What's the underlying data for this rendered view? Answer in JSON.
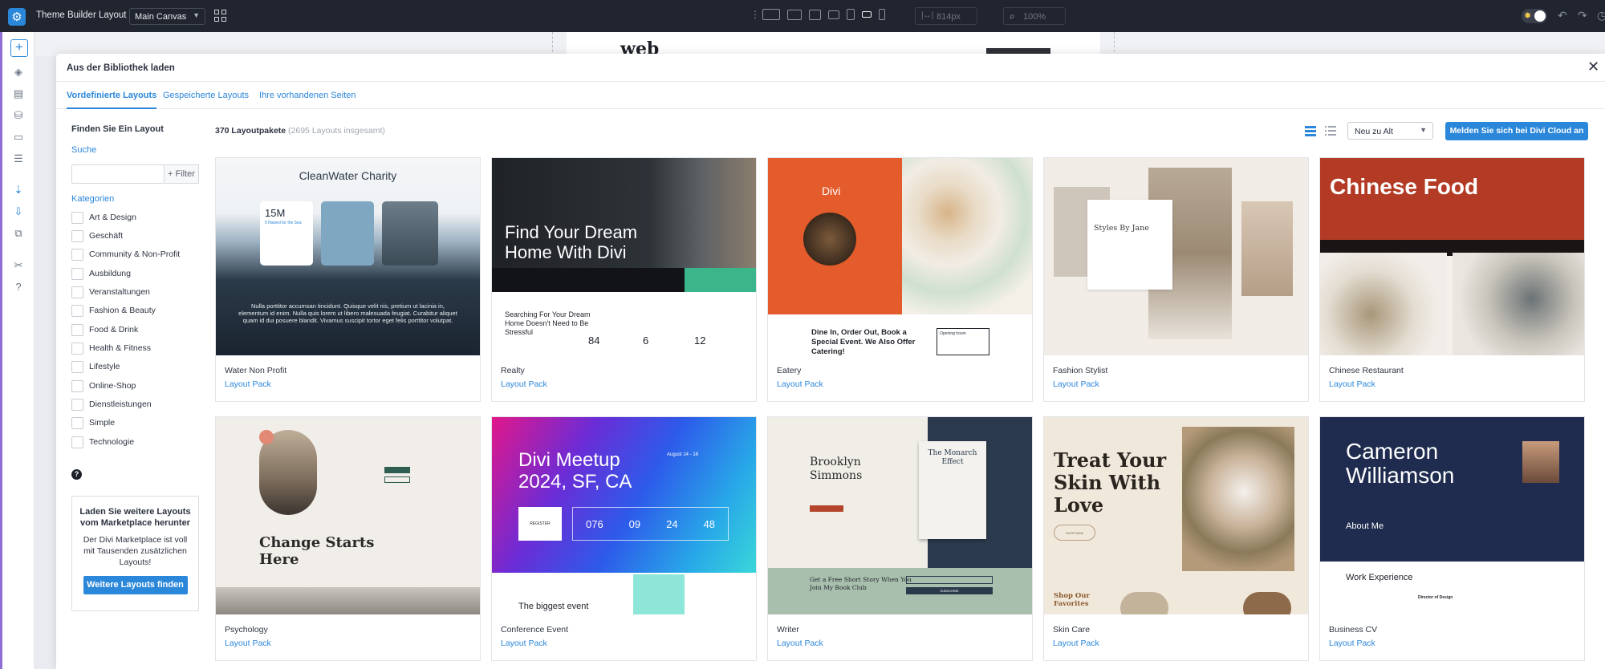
{
  "app": {
    "title": "Theme Builder Layout",
    "canvas_select": "Main Canvas",
    "width_value": "814px",
    "zoom_value": "100%",
    "accent": "#2b87da"
  },
  "canvas_preview": {
    "logo_text": "web"
  },
  "modal": {
    "title": "Aus der Bibliothek laden",
    "tabs": [
      "Vordefinierte Layouts",
      "Gespeicherte Layouts",
      "Ihre vorhandenen Seiten"
    ]
  },
  "sidebar": {
    "heading": "Finden Sie Ein Layout",
    "search_label": "Suche",
    "search_placeholder": "",
    "filter_label": "+ Filter",
    "categories_label": "Kategorien",
    "categories": [
      "Art & Design",
      "Geschäft",
      "Community & Non-Profit",
      "Ausbildung",
      "Veranstaltungen",
      "Fashion & Beauty",
      "Food & Drink",
      "Health & Fitness",
      "Lifestyle",
      "Online-Shop",
      "Dienstleistungen",
      "Simple",
      "Technologie"
    ],
    "promo_title": "Laden Sie weitere Layouts vom Marketplace herunter",
    "promo_text": "Der Divi Marketplace ist voll mit Tausenden zusätzlichen Layouts!",
    "promo_button": "Weitere Layouts finden"
  },
  "content": {
    "pack_count": "370 Layoutpakete",
    "pack_total": "(2695 Layouts insgesamt)",
    "sort_value": "Neu zu Alt",
    "cloud_button": "Melden Sie sich bei Divi Cloud an",
    "card_type_label": "Layout Pack"
  },
  "cards": [
    {
      "name": "Water Non Profit",
      "preview": {
        "title": "CleanWater Charity",
        "stat": "15M",
        "stat_sub": "5 Raised for the Sea",
        "body": "Nulla porttitor accumsan tincidunt. Quisque velit nis, pretium ut lacinia in, elementum id enim. Nulla quis lorem ut libero malesuada feugiat. Curabitur aliquet quam id dui posuere blandit. Vivamus suscipit tortor eget felis porttitor volutpat."
      }
    },
    {
      "name": "Realty",
      "preview": {
        "headline": "Find Your Dream Home With Divi",
        "sub": "Searching For Your Dream Home Doesn't Need to Be Stressful",
        "stats": [
          "84",
          "6",
          "12"
        ]
      }
    },
    {
      "name": "Eatery",
      "preview": {
        "brand": "Divi",
        "headline": "Dine In, Order Out, Book a Special Event. We Also Offer Catering!",
        "hours": "Opening hours"
      }
    },
    {
      "name": "Fashion Stylist",
      "preview": {
        "title": "Styles By Jane"
      }
    },
    {
      "name": "Chinese Restaurant",
      "preview": {
        "title": "Chinese Food"
      }
    },
    {
      "name": "Psychology",
      "preview": {
        "headline": "Change Starts Here"
      }
    },
    {
      "name": "Conference Event",
      "preview": {
        "headline": "Divi Meetup 2024, SF, CA",
        "date": "August 14 - 16",
        "countdown": [
          "076",
          "09",
          "24",
          "48"
        ],
        "register": "REGISTER",
        "teaser": "The biggest event"
      }
    },
    {
      "name": "Writer",
      "preview": {
        "author": "Brooklyn Simmons",
        "book": "The Monarch Effect",
        "cta": "Get a Free Short Story When You Join My Book Club",
        "subscribe": "SUBSCRIBE"
      }
    },
    {
      "name": "Skin Care",
      "preview": {
        "headline": "Treat Your Skin With Love",
        "sub": "Shop Our Favorites",
        "button": "SHOP NOW"
      }
    },
    {
      "name": "Business CV",
      "preview": {
        "name": "Cameron Williamson",
        "about": "About Me",
        "experience": "Work Experience",
        "role": "Director of Design"
      }
    }
  ]
}
